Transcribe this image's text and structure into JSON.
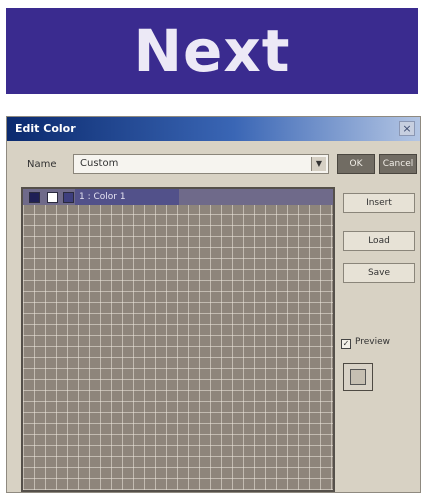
{
  "banner": {
    "text": "Next",
    "bg_color": "#3a2b8f",
    "text_color": "#ece9f6"
  },
  "window": {
    "title": "Edit Color",
    "close_icon": "close-icon",
    "name_label": "Name",
    "name_value": "Custom",
    "buttons": {
      "top_left": "OK",
      "top_right": "Cancel",
      "insert": "Insert",
      "load": "Load",
      "save": "Save"
    },
    "grid": {
      "selected_label": "1 : Color 1"
    },
    "preview_label": "Preview"
  }
}
